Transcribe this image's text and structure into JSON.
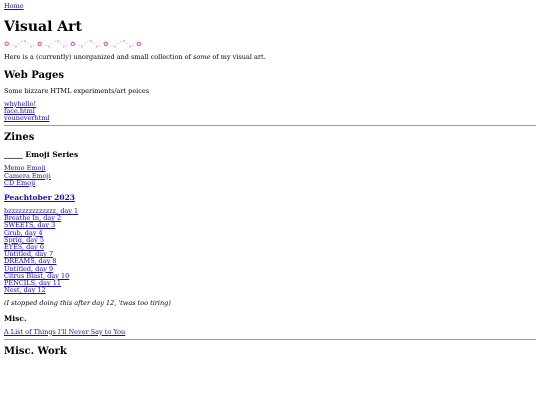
{
  "nav": {
    "home": "Home"
  },
  "title": "Visual Art",
  "decoration": "✿ .˳·ˊ˚·˳. ✿ .˳·ˊ˚·˳. ✿ .˳·ˊ˚·˳. ✿ .˳·ˊ˚·˳. ✿",
  "intro": {
    "before": "Here is a (currently) unorganized and small collection of ",
    "em": "some",
    "after": " of my visual art."
  },
  "web_pages": {
    "heading": "Web Pages",
    "description": "Some bizzare HTML experiments/art peices",
    "links": [
      "whyhello!",
      "face.html",
      "youneverhtml"
    ]
  },
  "zines": {
    "heading": "Zines",
    "emoji_series": {
      "heading": "_____ Emoji Series",
      "links": [
        "Memo Emoji",
        "Camera Emoji",
        "CD Emoji"
      ]
    },
    "peachtober": {
      "heading": "Peachtober 2023",
      "links": [
        "bzzzzzzzzzzzzzz, day 1",
        "Breathe In, day 2",
        "SWEETS, day 3",
        "Grub, day 4",
        "Sprig, day 5",
        "EYES, day 6",
        "Untitled, day 7",
        "DREAMS, day 8",
        "Untitled, day 9",
        "Citrus Blast, day 10",
        "PENCILS, day 11",
        "Nest, day 12"
      ],
      "note": "(I stopped doing this after day 12, 'twas too tiring)"
    },
    "misc": {
      "heading": "Misc.",
      "links": [
        "A List of Things I'll Never Say to You"
      ]
    }
  },
  "misc_work": {
    "heading": "Misc. Work"
  }
}
